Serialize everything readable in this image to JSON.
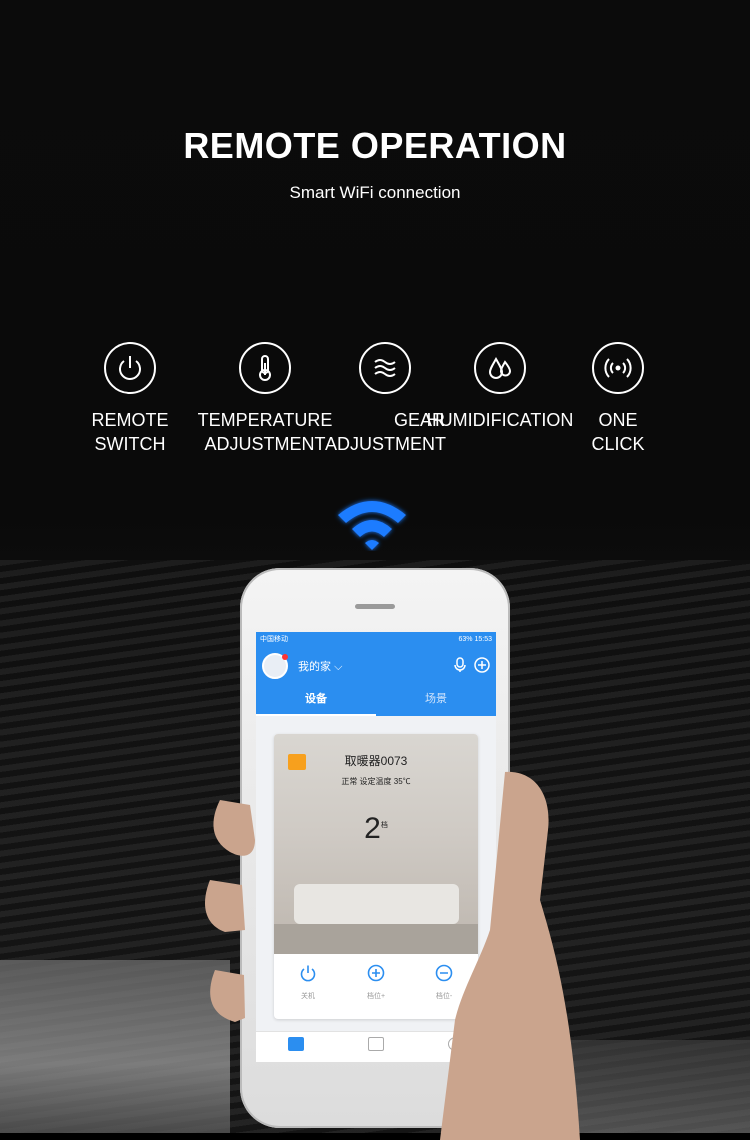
{
  "header": {
    "title": "REMOTE OPERATION",
    "subtitle": "Smart WiFi connection"
  },
  "features": [
    {
      "label": "REMOTE\nSWITCH",
      "icon": "power-icon"
    },
    {
      "label": "TEMPERATURE\nADJUSTMENT",
      "icon": "thermometer-icon"
    },
    {
      "label": "GEAR\nADJUSTMENT",
      "icon": "wind-icon"
    },
    {
      "label": "HUMIDIFICATION",
      "icon": "water-drops-icon"
    },
    {
      "label": "ONE\nCLICK",
      "icon": "broadcast-icon"
    }
  ],
  "phone": {
    "status": {
      "carrier": "中国移动",
      "battery": "63%",
      "time": "15:53"
    },
    "home_label": "我的家",
    "tabs": [
      {
        "label": "设备",
        "active": true
      },
      {
        "label": "场景",
        "active": false
      }
    ],
    "device": {
      "name": "取暖器0073",
      "status": "正常 设定温度 35℃",
      "level": "2",
      "level_unit": "档"
    },
    "controls": [
      {
        "label": "关机",
        "icon": "power-icon"
      },
      {
        "label": "档位+",
        "icon": "plus-circle-icon"
      },
      {
        "label": "档位-",
        "icon": "minus-circle-icon"
      }
    ]
  },
  "colors": {
    "accent": "#2b8ef0",
    "wifi": "#1e7bff",
    "badge": "#f7a01d"
  }
}
